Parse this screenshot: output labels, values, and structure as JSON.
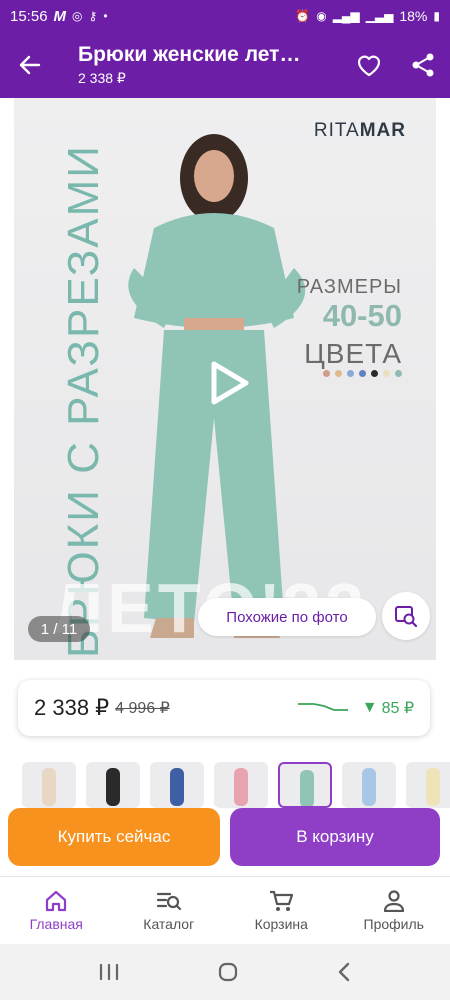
{
  "status_bar": {
    "time": "15:56",
    "app_badge": "M",
    "battery": "18%"
  },
  "header": {
    "title": "Брюки женские лет…",
    "price": "2 338 ₽"
  },
  "promo_image": {
    "vertical_text": "БРЮКИ С РАЗРЕЗАМИ",
    "brand_part1": "RITA",
    "brand_part2": "MAR",
    "sizes_label": "РАЗМЕРЫ",
    "sizes_value": "40-50",
    "colors_label": "ЦВЕТА",
    "watermark": "ЛЕТО'22",
    "color_dots": [
      "#d49a8a",
      "#e0b98f",
      "#8aa8d8",
      "#5f80c0",
      "#2a2a2a",
      "#eadfc0",
      "#8fbbb0"
    ],
    "counter": "1 / 11",
    "similar_label": "Похожие по фото"
  },
  "price_card": {
    "price": "2 338 ₽",
    "old_price": "4 996 ₽",
    "drop_value": "85 ₽",
    "drop_color": "#3aa55b"
  },
  "thumbnails": [
    {
      "color": "#e8d7c2"
    },
    {
      "color": "#2a2a2a"
    },
    {
      "color": "#3f5fa4"
    },
    {
      "color": "#e8a3b0"
    },
    {
      "color": "#8fc4b6",
      "selected": true
    },
    {
      "color": "#a8c6e6"
    },
    {
      "color": "#efe3b8"
    }
  ],
  "actions": {
    "buy_now": "Купить сейчас",
    "add_to_cart": "В корзину"
  },
  "bottom_nav": {
    "items": [
      {
        "label": "Главная",
        "icon": "home-icon",
        "active": true
      },
      {
        "label": "Каталог",
        "icon": "catalog-search-icon"
      },
      {
        "label": "Корзина",
        "icon": "cart-icon"
      },
      {
        "label": "Профиль",
        "icon": "profile-icon"
      }
    ]
  },
  "colors": {
    "brand_purple": "#6c1fa6",
    "accent_purple": "#8e3fc6",
    "orange": "#f7921e",
    "mint": "#8fc4b6"
  }
}
